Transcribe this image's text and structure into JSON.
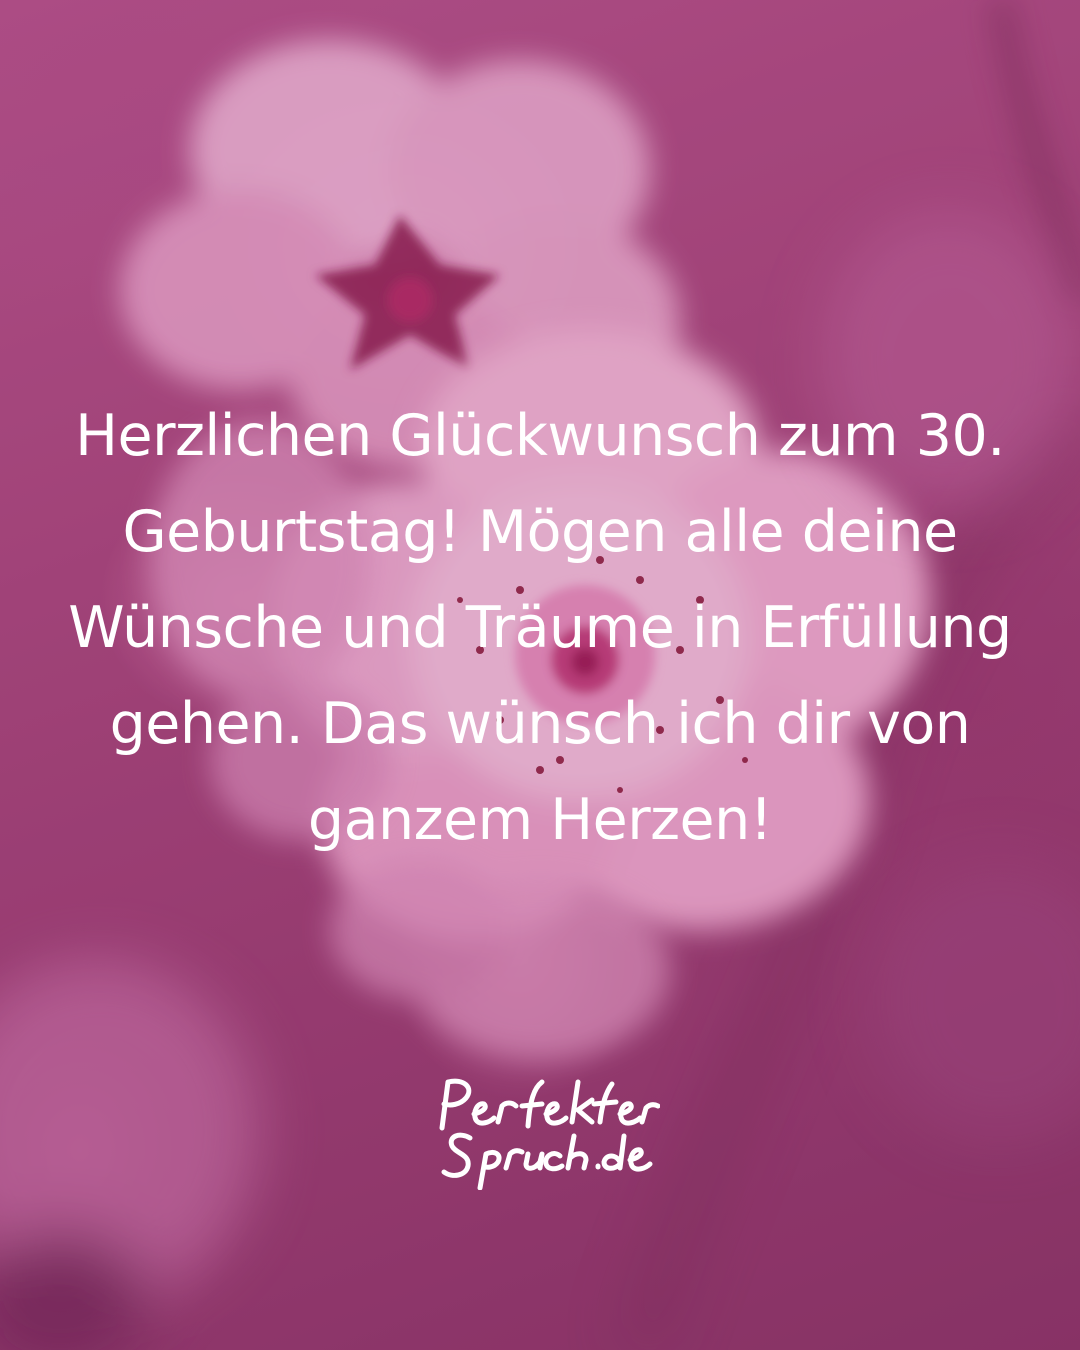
{
  "quote": {
    "text": "Herzlichen Glückwunsch zum 30. Geburtstag! Mögen alle deine Wünsche und Träume in Erfüllung gehen. Das wünsch ich dir von ganzem Herzen!"
  },
  "logo": {
    "line1": "Perfekter",
    "line2": "Spruch.de"
  },
  "colors": {
    "background": "#a9497f",
    "blossom_light": "#f4b6d8",
    "blossom_center": "#8a1a4a",
    "text": "#ffffff"
  }
}
